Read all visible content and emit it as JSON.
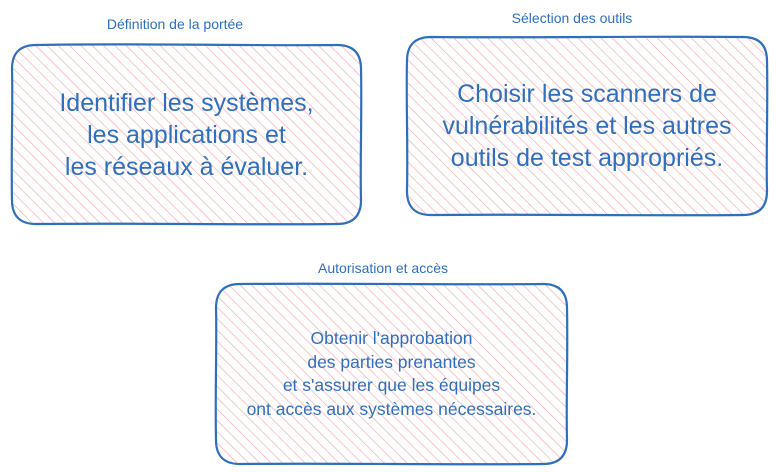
{
  "colors": {
    "stroke": "#2f6fbf",
    "hatch": "#f4a7ae",
    "text": "#2f6fbf"
  },
  "sections": [
    {
      "title": "Définition de la portée",
      "lines": [
        "Identifier les systèmes,",
        "les applications et",
        "les réseaux à évaluer."
      ]
    },
    {
      "title": "Sélection des outils",
      "lines": [
        "Choisir les scanners de",
        "vulnérabilités et les autres",
        "outils de test appropriés."
      ]
    },
    {
      "title": "Autorisation et accès",
      "lines": [
        "Obtenir l'approbation",
        "des parties prenantes",
        "et s'assurer que les équipes",
        "ont accès aux systèmes nécessaires."
      ]
    }
  ]
}
